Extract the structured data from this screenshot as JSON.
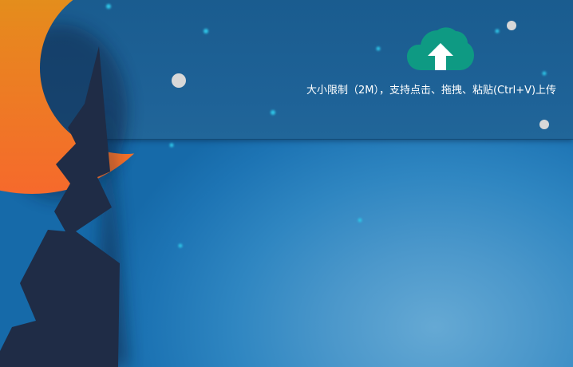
{
  "upload": {
    "hint": "大小限制（2M），支持点击、拖拽、粘贴(Ctrl+V)上传",
    "icon": "cloud-upload-icon",
    "icon_color": "#0e9a83"
  },
  "theme": {
    "background": "#1d74b4",
    "band": "#1e6297",
    "moon_gradient": [
      "#d9a211",
      "#f4662c"
    ],
    "tree_color": "#1f2d47"
  },
  "scene_icons": [
    "crescent-moon-icon",
    "tree-silhouette-icon",
    "star-icon"
  ]
}
